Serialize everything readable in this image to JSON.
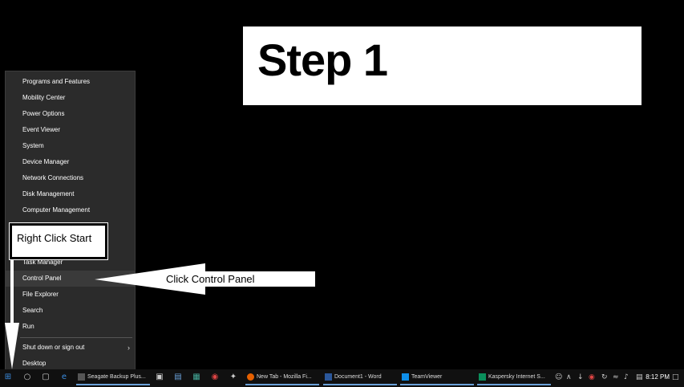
{
  "step": {
    "title": "Step 1"
  },
  "menu": {
    "items_top": [
      "Programs and Features",
      "Mobility Center",
      "Power Options",
      "Event Viewer",
      "System",
      "Device Manager",
      "Network Connections",
      "Disk Management",
      "Computer Management"
    ],
    "items_mid": [
      "Task Manager",
      "Control Panel",
      "File Explorer",
      "Search",
      "Run"
    ],
    "shutdown_label": "Shut down or sign out",
    "desktop_label": "Desktop"
  },
  "annotations": {
    "right_click_label": "Right Click Start",
    "control_panel_label": "Click Control Panel"
  },
  "taskbar": {
    "apps": [
      "Seagate Backup Plus...",
      "New Tab - Mozilla Fi...",
      "Document1 - Word",
      "TeamViewer",
      "Kaspersky Internet S..."
    ],
    "clock": "8:12 PM"
  },
  "colors": {
    "accent": "#6aa0d8",
    "menu_bg": "#2b2b2b"
  }
}
